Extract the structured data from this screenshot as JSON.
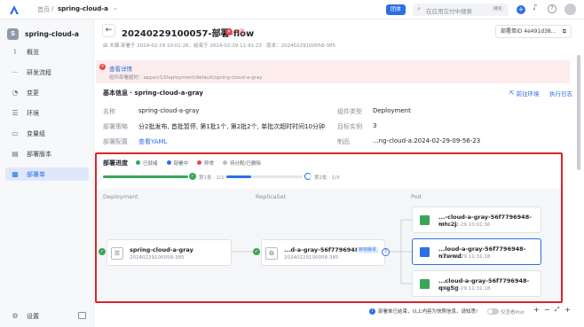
{
  "topbar": {
    "breadcrumb_home": "首页",
    "breadcrumb_app": "spring-cloud-a",
    "chip": "团体",
    "search_placeholder": "在应用交付中搜索",
    "shortcut": "⌘K"
  },
  "sidebar": {
    "app_initial": "S",
    "app_name": "spring-cloud-a",
    "items": [
      {
        "label": "概览",
        "icon": "chart-icon"
      },
      {
        "label": "研发流程",
        "icon": "flow-icon"
      },
      {
        "label": "变更",
        "icon": "change-icon"
      },
      {
        "label": "环境",
        "icon": "environment-icon"
      },
      {
        "label": "变量组",
        "icon": "variable-icon"
      },
      {
        "label": "部署版本",
        "icon": "version-icon"
      },
      {
        "label": "部署单",
        "icon": "deploy-order-icon"
      }
    ],
    "active_index": 6,
    "settings_label": "设置"
  },
  "header": {
    "title": "20240229100057-部署-flow",
    "status": "失败",
    "meta": "由 木烟 部署于 2024-02-29 10:01:26，结束于 2024-02-29 11:41:23 · 版本：20240229100058-385",
    "order_id_btn": "部署单ID 4e491d38..."
  },
  "alert": {
    "link": "查看详情",
    "text": "组件部署超时：apps/v1/Deployment/default/spring-cloud-a-gray"
  },
  "basic": {
    "title": "基本信息 · spring-cloud-a-gray",
    "goto_env": "前往环境",
    "exec_log": "执行日志",
    "rows": [
      {
        "k1": "名称",
        "v1": "spring-cloud-a-gray",
        "k2": "组件类型",
        "v2": "Deployment"
      },
      {
        "k1": "部署策略",
        "v1": "分2批发布, 首批暂停, 第1批1个, 第2批2个, 单批次超时时间10分钟",
        "k2": "目标实例",
        "v2": "3"
      },
      {
        "k1": "部署配置",
        "v1": "查看YAML",
        "k2": "制品",
        "v2": "...ng-cloud-a:2024-02-29-09-56-23"
      }
    ]
  },
  "progress": {
    "title": "部署进度",
    "legend": [
      "已就绪",
      "部署中",
      "异常",
      "待分配/已删除"
    ],
    "legend_colors": [
      "#3aa55a",
      "#2b6fe6",
      "#e5484d",
      "#b8bcc4"
    ],
    "batch1": "第1批 · 1/1",
    "batch2": "第2批 · 1/3",
    "batch1_fraction": 1.0,
    "batch2_fraction": 0.33
  },
  "topology": {
    "col_deployment": "Deployment",
    "col_replicaset": "ReplicaSet",
    "col_pod": "Pod",
    "deployment": {
      "name": "spring-cloud-a-gray",
      "version": "20240229100058-385"
    },
    "replicaset": {
      "name": "...d-a-gray-56f7796948",
      "version": "20240229100058-385",
      "tag": "目标版本",
      "count": "3"
    },
    "pods": [
      {
        "name": "...-cloud-a-gray-56f7796948-mtc2j",
        "time": "2024-02-29 10:01:36",
        "color": "#3aa55a"
      },
      {
        "name": "...loud-a-gray-56f7796948-n7wwd",
        "time": "2024-02-29 11:31:18",
        "color": "#2b6fe6"
      },
      {
        "name": "...cloud-a-gray-56f7796948-qxg5g",
        "time": "2024-02-29 11:31:18",
        "color": "#3aa55a"
      }
    ]
  },
  "footer": {
    "info": "部署单已结束，以上内容为快照信息，请知悉!",
    "toggle_label": "仅查看Pod"
  }
}
